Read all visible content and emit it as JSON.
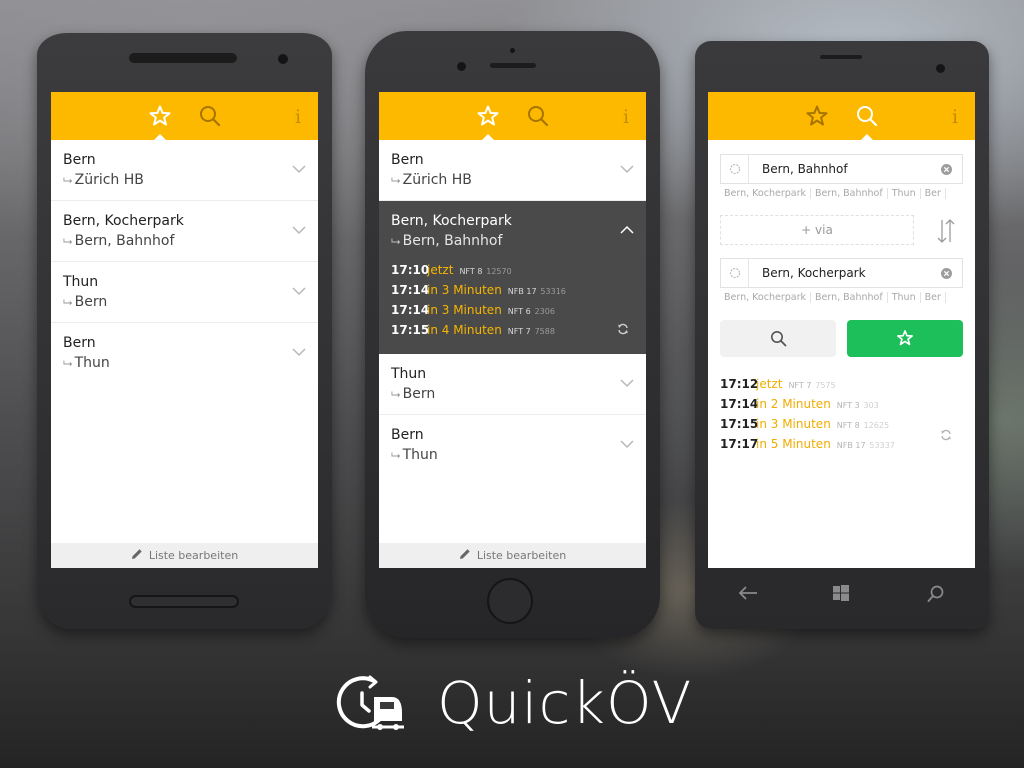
{
  "brand": {
    "name": "QuickÖV"
  },
  "colors": {
    "accent": "#fcb900",
    "header_icon": "#a87400",
    "favorite_button": "#1cbf5a",
    "relative_time": "#f7b400",
    "expanded_bg": "#4a4a4a"
  },
  "icons": [
    "star-icon",
    "search-icon",
    "info-icon",
    "chevron-down-icon",
    "chevron-up-icon",
    "refresh-icon",
    "pencil-icon",
    "location-icon",
    "clear-icon",
    "swap-icon",
    "back-icon",
    "windows-icon"
  ],
  "header": {
    "info_label": "i"
  },
  "favorites": [
    {
      "from": "Bern",
      "to": "Zürich HB"
    },
    {
      "from": "Bern, Kocherpark",
      "to": "Bern, Bahnhof"
    },
    {
      "from": "Thun",
      "to": "Bern"
    },
    {
      "from": "Bern",
      "to": "Thun"
    }
  ],
  "arrow_glyph": "⮡",
  "expanded_departures": [
    {
      "time": "17:10",
      "relative": "jetzt",
      "line": "NFT 8",
      "number": "12570"
    },
    {
      "time": "17:14",
      "relative": "in 3 Minuten",
      "line": "NFB 17",
      "number": "53316"
    },
    {
      "time": "17:14",
      "relative": "in 3 Minuten",
      "line": "NFT 6",
      "number": "2306"
    },
    {
      "time": "17:15",
      "relative": "in 4 Minuten",
      "line": "NFT 7",
      "number": "7588"
    }
  ],
  "footer": {
    "edit_label": "Liste bearbeiten"
  },
  "search": {
    "from_value": "Bern, Bahnhof",
    "from_suggestions": [
      "Bern, Kocherpark",
      "Bern, Bahnhof",
      "Thun",
      "Ber"
    ],
    "via_label": "+ via",
    "to_value": "Bern, Kocherpark",
    "to_suggestions": [
      "Bern, Kocherpark",
      "Bern, Bahnhof",
      "Thun",
      "Ber"
    ],
    "results": [
      {
        "time": "17:12",
        "relative": "jetzt",
        "line": "NFT 7",
        "number": "7575"
      },
      {
        "time": "17:14",
        "relative": "in 2 Minuten",
        "line": "NFT 3",
        "number": "303"
      },
      {
        "time": "17:15",
        "relative": "in 3 Minuten",
        "line": "NFT 8",
        "number": "12625"
      },
      {
        "time": "17:17",
        "relative": "in 5 Minuten",
        "line": "NFB 17",
        "number": "53337"
      }
    ]
  }
}
